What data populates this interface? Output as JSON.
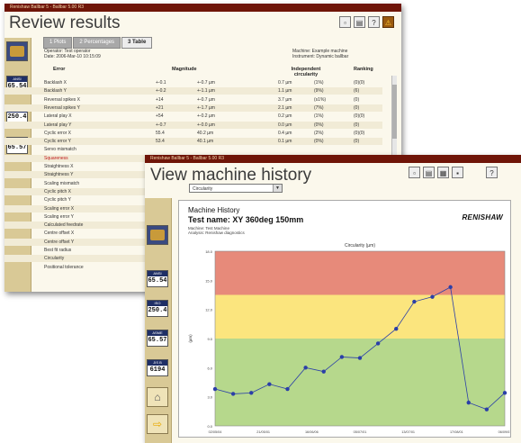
{
  "back_window": {
    "titlebar_text": "Renishaw Ballbar 5 - Ballbar 5.00 R3",
    "title": "Review results",
    "tabs": [
      "1 Plots",
      "2 Percentages",
      "3 Table"
    ],
    "info_left": [
      "Operator: Test operator",
      "Date: 2006-Mar-10 10:15:09"
    ],
    "info_right": [
      "Machine: Example machine",
      "Instrument: Dynamic ballbar"
    ],
    "columns": {
      "error": "Error",
      "magnitude": "Magnitude",
      "circularity": "Independent circularity",
      "ranking": "Ranking"
    },
    "rows": [
      {
        "error": "Backlash X",
        "mag1": "+-0.1",
        "mag2": "+-0.7 µm",
        "circ": "0.7 µm",
        "pct": "(1%)",
        "rank": "(0)(0)",
        "color": "normal"
      },
      {
        "error": "Backlash Y",
        "mag1": "+-0.2",
        "mag2": "+-1.1 µm",
        "circ": "1.1 µm",
        "pct": "(9%)",
        "rank": "(6)",
        "color": "normal"
      },
      {
        "error": "Reversal spikes X",
        "mag1": "+14",
        "mag2": "+-0.7 µm",
        "circ": "3.7 µm",
        "pct": "(s1%)",
        "rank": "(0)",
        "color": "normal"
      },
      {
        "error": "Reversal spikes Y",
        "mag1": "+21",
        "mag2": "+-1.7 µm",
        "circ": "2.1 µm",
        "pct": "(7%)",
        "rank": "(0)",
        "color": "normal"
      },
      {
        "error": "Lateral play X",
        "mag1": "+54",
        "mag2": "+-0.2 µm",
        "circ": "0.2 µm",
        "pct": "(1%)",
        "rank": "(0)(0)",
        "color": "normal"
      },
      {
        "error": "Lateral play Y",
        "mag1": "+-0.7",
        "mag2": "+-0.0 µm",
        "circ": "0.0 µm",
        "pct": "(0%)",
        "rank": "(0)",
        "color": "normal"
      },
      {
        "error": "Cyclic error X",
        "mag1": "55.4",
        "mag2": "40.2 µm",
        "circ": "0.4 µm",
        "pct": "(2%)",
        "rank": "(0)(0)",
        "color": "normal"
      },
      {
        "error": "Cyclic error Y",
        "mag1": "53.4",
        "mag2": "40.1 µm",
        "circ": "0.1 µm",
        "pct": "(0%)",
        "rank": "(0)",
        "color": "normal"
      },
      {
        "error": "Servo mismatch",
        "mag1": "",
        "mag2": "",
        "circ": "",
        "pct": "",
        "rank": "",
        "color": "normal"
      },
      {
        "error": "Squareness",
        "mag1": "",
        "mag2": "",
        "circ": "",
        "pct": "",
        "rank": "",
        "color": "red"
      },
      {
        "error": "Straightness X",
        "mag1": "",
        "mag2": "",
        "circ": "",
        "pct": "",
        "rank": "",
        "color": "normal"
      },
      {
        "error": "Straightness Y",
        "mag1": "",
        "mag2": "",
        "circ": "",
        "pct": "",
        "rank": "",
        "color": "normal"
      },
      {
        "error": "Scaling mismatch",
        "mag1": "",
        "mag2": "",
        "circ": "",
        "pct": "",
        "rank": "",
        "color": "normal"
      },
      {
        "error": "Cyclic pitch X",
        "mag1": "",
        "mag2": "",
        "circ": "",
        "pct": "",
        "rank": "",
        "color": "normal"
      },
      {
        "error": "Cyclic pitch Y",
        "mag1": "",
        "mag2": "",
        "circ": "",
        "pct": "",
        "rank": "",
        "color": "normal"
      },
      {
        "error": "Scaling error X",
        "mag1": "",
        "mag2": "",
        "circ": "",
        "pct": "",
        "rank": "",
        "color": "normal"
      },
      {
        "error": "Scaling error Y",
        "mag1": "",
        "mag2": "",
        "circ": "",
        "pct": "",
        "rank": "",
        "color": "normal"
      },
      {
        "error": "Calculated feedrate",
        "mag1": "",
        "mag2": "",
        "circ": "",
        "pct": "",
        "rank": "",
        "color": "normal"
      },
      {
        "error": "Centre offset X",
        "mag1": "",
        "mag2": "",
        "circ": "",
        "pct": "",
        "rank": "",
        "color": "normal"
      },
      {
        "error": "Centre offset Y",
        "mag1": "",
        "mag2": "",
        "circ": "",
        "pct": "",
        "rank": "",
        "color": "normal"
      },
      {
        "error": "Best fit radius",
        "mag1": "",
        "mag2": "",
        "circ": "",
        "pct": "",
        "rank": "",
        "color": "normal"
      },
      {
        "error": "Circularity",
        "mag1": "",
        "mag2": "",
        "circ": "",
        "pct": "",
        "rank": "",
        "color": "normal"
      },
      {
        "error": "Positional tolerance",
        "mag1": "",
        "mag2": "",
        "circ": "",
        "pct": "",
        "rank": "",
        "color": "normal"
      }
    ],
    "sidebar_values": [
      "65.54",
      "250.4",
      "65.57"
    ],
    "sidebar_tops": [
      "ANSI",
      "ISO",
      "ASME"
    ]
  },
  "front_window": {
    "titlebar_text": "Renishaw Ballbar 5 - Ballbar 5.00 R3",
    "title": "View machine history",
    "dropdown": "Circularity",
    "header_title": "Machine History",
    "test_name": "Test name: XY 360deg 150mm",
    "machine_line": "Machine: Test Machine",
    "analysis_line": "Analysis: Renishaw diagnostics",
    "logo": "RENISHAW",
    "sidebar_values": [
      "65.54",
      "250.4",
      "65.57",
      "6194"
    ],
    "sidebar_tops": [
      "ANSI",
      "ISO",
      "ASME",
      "JIS B"
    ]
  },
  "chart_data": {
    "type": "line",
    "title": "Circularity (µm)",
    "ylabel": "(µm)",
    "ylim": [
      0,
      18
    ],
    "yticks": [
      "0.0",
      "3.0",
      "6.0",
      "9.0",
      "12.0",
      "15.0",
      "18.0"
    ],
    "xticks": [
      "02/05/04",
      "21/05/01",
      "16/06/06",
      "05/07/01",
      "13/07/01",
      "17/08/01",
      "06/09/01"
    ],
    "bands": [
      {
        "from": 0,
        "to": 9,
        "color": "#b6d88c"
      },
      {
        "from": 9,
        "to": 13.5,
        "color": "#fbe57e"
      },
      {
        "from": 13.5,
        "to": 18,
        "color": "#e78a7a"
      }
    ],
    "series": [
      {
        "color": "#2b3fa8",
        "values": [
          3.8,
          3.3,
          3.4,
          4.3,
          3.8,
          6.0,
          5.6,
          7.1,
          7.0,
          8.5,
          10.0,
          12.8,
          13.3,
          14.3,
          2.4,
          1.7,
          3.4
        ]
      }
    ]
  }
}
